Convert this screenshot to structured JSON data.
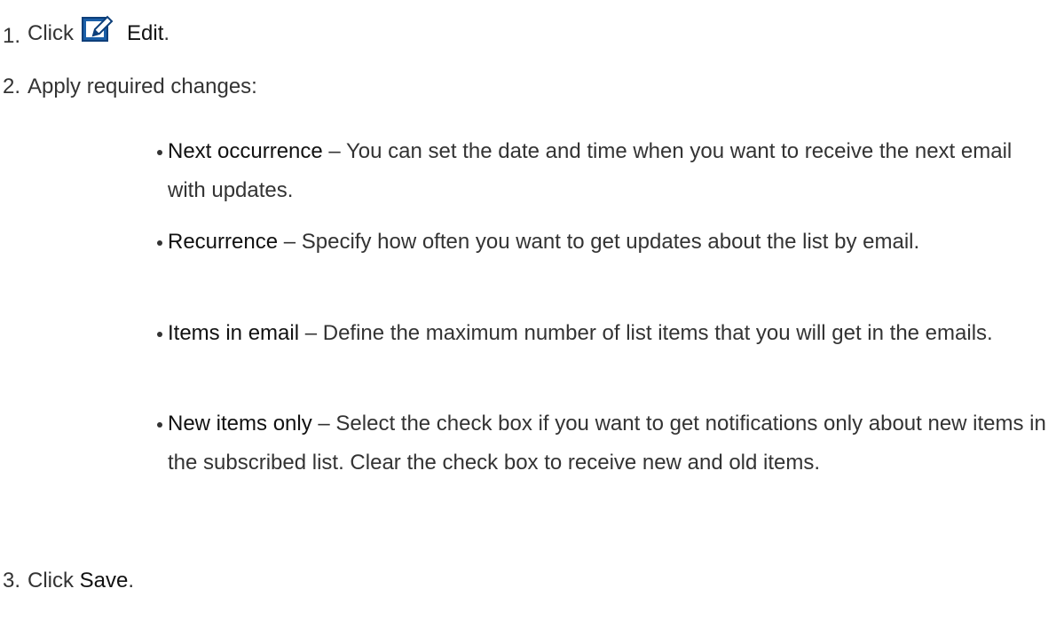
{
  "steps": [
    {
      "number": "1.",
      "text_before": "Click",
      "bold": "Edit",
      "text_after": ".",
      "icon": "edit-icon"
    },
    {
      "number": "2.",
      "text": "Apply required changes:"
    },
    {
      "number": "3.",
      "text_before": "Click",
      "bold": "Save",
      "text_after": "."
    }
  ],
  "bullets": [
    {
      "term": "Next occurrence",
      "sep": " – ",
      "desc": "You can set the date and time when you want to receive the next email with updates."
    },
    {
      "term": "Recurrence",
      "sep": " – ",
      "desc": "Specify how often you want to get updates about the list by email."
    },
    {
      "term": "Items in email",
      "sep": " – ",
      "desc": "Define the maximum number of list items that you will get in the emails."
    },
    {
      "term": "New items only",
      "sep": " – ",
      "desc": "Select the check box if you want to get notifications only about new items in the subscribed list. Clear the check box to receive new and old items."
    }
  ],
  "colors": {
    "text": "#333333",
    "icon_blue": "#1b5fa8"
  }
}
